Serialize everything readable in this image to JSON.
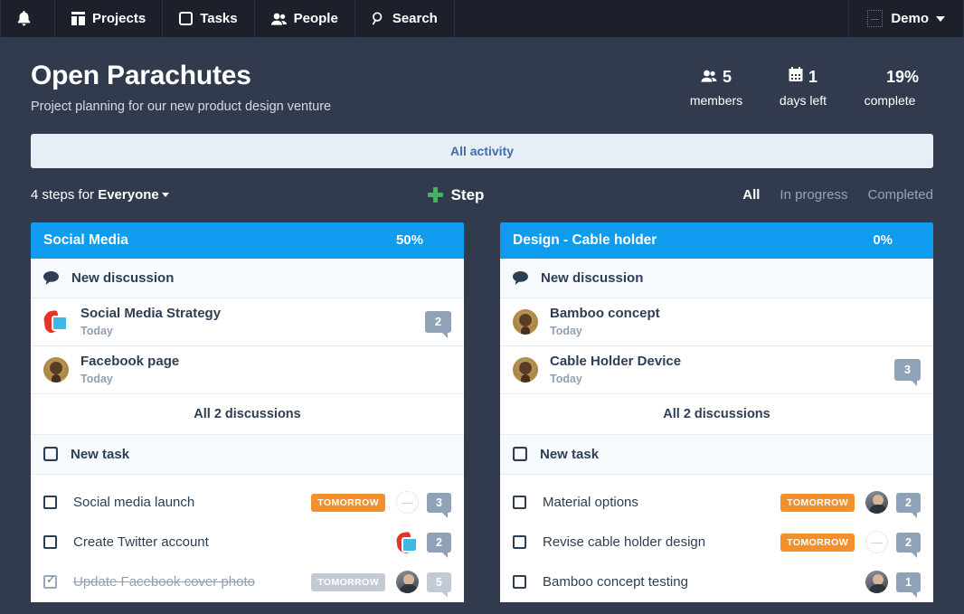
{
  "topnav": {
    "bell_icon": "bell-icon",
    "items": [
      {
        "label": "Projects",
        "icon": "projects-icon"
      },
      {
        "label": "Tasks",
        "icon": "tasks-icon"
      },
      {
        "label": "People",
        "icon": "people-icon"
      },
      {
        "label": "Search",
        "icon": "search-icon"
      }
    ],
    "account": {
      "name": "Demo",
      "avatar": "broken-image-avatar",
      "caret": "chevron-down-icon"
    }
  },
  "project": {
    "title": "Open Parachutes",
    "subtitle": "Project planning for our new product design venture",
    "stats": [
      {
        "value": "5",
        "label": "members",
        "icon": "members-icon"
      },
      {
        "value": "1",
        "label": "days left",
        "icon": "calendar-icon"
      },
      {
        "value": "19%",
        "label": "complete",
        "icon": "donut-progress-icon",
        "percent": 19
      }
    ]
  },
  "activity_bar": {
    "label": "All activity"
  },
  "toolbar": {
    "steps_count_text": "4 steps for ",
    "steps_scope": "Everyone",
    "add_step_label": "Step",
    "filters": [
      {
        "label": "All",
        "active": true
      },
      {
        "label": "In progress",
        "active": false
      },
      {
        "label": "Completed",
        "active": false
      }
    ]
  },
  "colors": {
    "page_bg": "#313b4d",
    "nav_bg": "#1b202b",
    "card_header_blue": "#0e9bf0",
    "accent_green": "#3cb660",
    "due_orange": "#f4902b",
    "badge_slate": "#8fa2b8",
    "badge_muted": "#c1cad5",
    "donut_yellow": "#e8b93c",
    "activity_bg": "#e8eef5",
    "activity_text": "#3f6ea8"
  },
  "cards": [
    {
      "title": "Social Media",
      "percent_label": "50%",
      "percent": 50,
      "new_discussion_label": "New discussion",
      "discussions": [
        {
          "title": "Social Media Strategy",
          "date": "Today",
          "avatar": "red",
          "comments": "2",
          "muted": false
        },
        {
          "title": "Facebook page",
          "date": "Today",
          "avatar": "gold",
          "comments": null,
          "muted": false
        }
      ],
      "all_discussions_label": "All 2 discussions",
      "new_task_label": "New task",
      "tasks": [
        {
          "name": "Social media launch",
          "due": "TOMORROW",
          "done": false,
          "avatar": "ph",
          "comments": "3"
        },
        {
          "name": "Create Twitter account",
          "due": null,
          "done": false,
          "avatar": "red",
          "comments": "2"
        },
        {
          "name": "Update Facebook cover photo",
          "due": "TOMORROW",
          "done": true,
          "avatar": "photo",
          "comments": "5"
        }
      ]
    },
    {
      "title": "Design - Cable holder",
      "percent_label": "0%",
      "percent": 0,
      "new_discussion_label": "New discussion",
      "discussions": [
        {
          "title": "Bamboo concept",
          "date": "Today",
          "avatar": "gold",
          "comments": null,
          "muted": false
        },
        {
          "title": "Cable Holder Device",
          "date": "Today",
          "avatar": "gold",
          "comments": "3",
          "muted": false
        }
      ],
      "all_discussions_label": "All 2 discussions",
      "new_task_label": "New task",
      "tasks": [
        {
          "name": "Material options",
          "due": "TOMORROW",
          "done": false,
          "avatar": "photo",
          "comments": "2"
        },
        {
          "name": "Revise cable holder design",
          "due": "TOMORROW",
          "done": false,
          "avatar": "ph",
          "comments": "2"
        },
        {
          "name": "Bamboo concept testing",
          "due": null,
          "done": false,
          "avatar": "photo",
          "comments": "1"
        }
      ]
    }
  ]
}
